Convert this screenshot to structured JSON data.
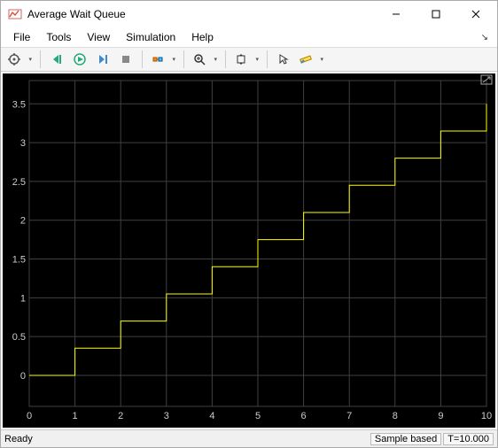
{
  "window": {
    "title": "Average Wait Queue"
  },
  "menu": {
    "items": [
      "File",
      "Tools",
      "View",
      "Simulation",
      "Help"
    ]
  },
  "toolbar": {
    "buttons": [
      {
        "name": "config",
        "type": "drop"
      },
      {
        "name": "sep"
      },
      {
        "name": "step-back"
      },
      {
        "name": "run"
      },
      {
        "name": "step-fwd"
      },
      {
        "name": "stop"
      },
      {
        "name": "sep"
      },
      {
        "name": "highlight",
        "type": "drop"
      },
      {
        "name": "sep"
      },
      {
        "name": "zoom",
        "type": "drop"
      },
      {
        "name": "sep"
      },
      {
        "name": "autoscale",
        "type": "drop"
      },
      {
        "name": "sep"
      },
      {
        "name": "cursor"
      },
      {
        "name": "measure",
        "type": "drop"
      }
    ]
  },
  "status": {
    "ready": "Ready",
    "mode": "Sample based",
    "time": "T=10.000"
  },
  "chart_data": {
    "type": "step",
    "title": "Average Wait Queue",
    "xlabel": "",
    "ylabel": "",
    "xlim": [
      0,
      10
    ],
    "ylim": [
      -0.4,
      3.8
    ],
    "xticks": [
      0,
      1,
      2,
      3,
      4,
      5,
      6,
      7,
      8,
      9,
      10
    ],
    "yticks": [
      0,
      0.5,
      1,
      1.5,
      2,
      2.5,
      3,
      3.5
    ],
    "x": [
      0,
      1,
      2,
      3,
      4,
      5,
      6,
      7,
      8,
      9,
      10
    ],
    "y": [
      0,
      0.35,
      0.7,
      1.05,
      1.4,
      1.75,
      2.1,
      2.45,
      2.8,
      3.15,
      3.5
    ],
    "line_color": "#ffff00",
    "grid": true
  }
}
